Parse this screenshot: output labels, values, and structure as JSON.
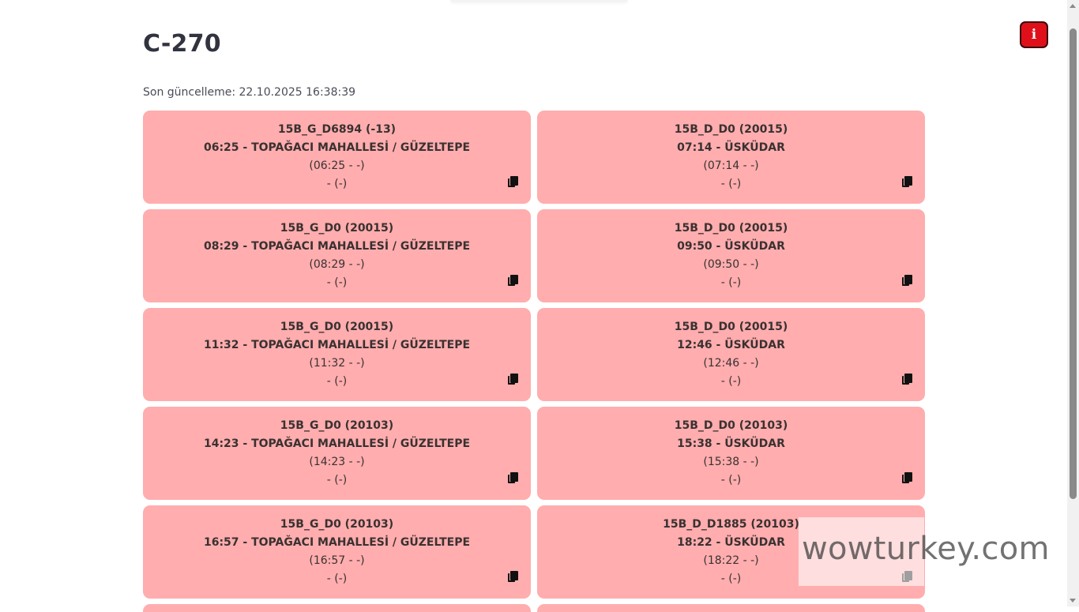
{
  "page": {
    "title": "C-270",
    "last_update": "Son güncelleme: 22.10.2025 16:38:39"
  },
  "info_button": {
    "label": "i",
    "color": "#e0101a"
  },
  "colors": {
    "card_background": "#ffadae"
  },
  "trips": [
    {
      "code": "15B_G_D6894 (-13)",
      "departure": "06:25 - TOPAĞACI MAHALLESİ / GÜZELTEPE",
      "planned": "(06:25 - -)",
      "status": "- (-)"
    },
    {
      "code": "15B_D_D0 (20015)",
      "departure": "07:14 - ÜSKÜDAR",
      "planned": "(07:14 - -)",
      "status": "- (-)"
    },
    {
      "code": "15B_G_D0 (20015)",
      "departure": "08:29 - TOPAĞACI MAHALLESİ / GÜZELTEPE",
      "planned": "(08:29 - -)",
      "status": "- (-)"
    },
    {
      "code": "15B_D_D0 (20015)",
      "departure": "09:50 - ÜSKÜDAR",
      "planned": "(09:50 - -)",
      "status": "- (-)"
    },
    {
      "code": "15B_G_D0 (20015)",
      "departure": "11:32 - TOPAĞACI MAHALLESİ / GÜZELTEPE",
      "planned": "(11:32 - -)",
      "status": "- (-)"
    },
    {
      "code": "15B_D_D0 (20015)",
      "departure": "12:46 - ÜSKÜDAR",
      "planned": "(12:46 - -)",
      "status": "- (-)"
    },
    {
      "code": "15B_G_D0 (20103)",
      "departure": "14:23 - TOPAĞACI MAHALLESİ / GÜZELTEPE",
      "planned": "(14:23 - -)",
      "status": "- (-)"
    },
    {
      "code": "15B_D_D0 (20103)",
      "departure": "15:38 - ÜSKÜDAR",
      "planned": "(15:38 - -)",
      "status": "- (-)"
    },
    {
      "code": "15B_G_D0 (20103)",
      "departure": "16:57 - TOPAĞACI MAHALLESİ / GÜZELTEPE",
      "planned": "(16:57 - -)",
      "status": "- (-)"
    },
    {
      "code": "15B_D_D1885 (20103)",
      "departure": "18:22 - ÜSKÜDAR",
      "planned": "(18:22 - -)",
      "status": "- (-)"
    }
  ],
  "icons": {
    "copy": "copy-icon",
    "info": "info-icon"
  },
  "watermark": {
    "text": "wowturkey.com"
  }
}
